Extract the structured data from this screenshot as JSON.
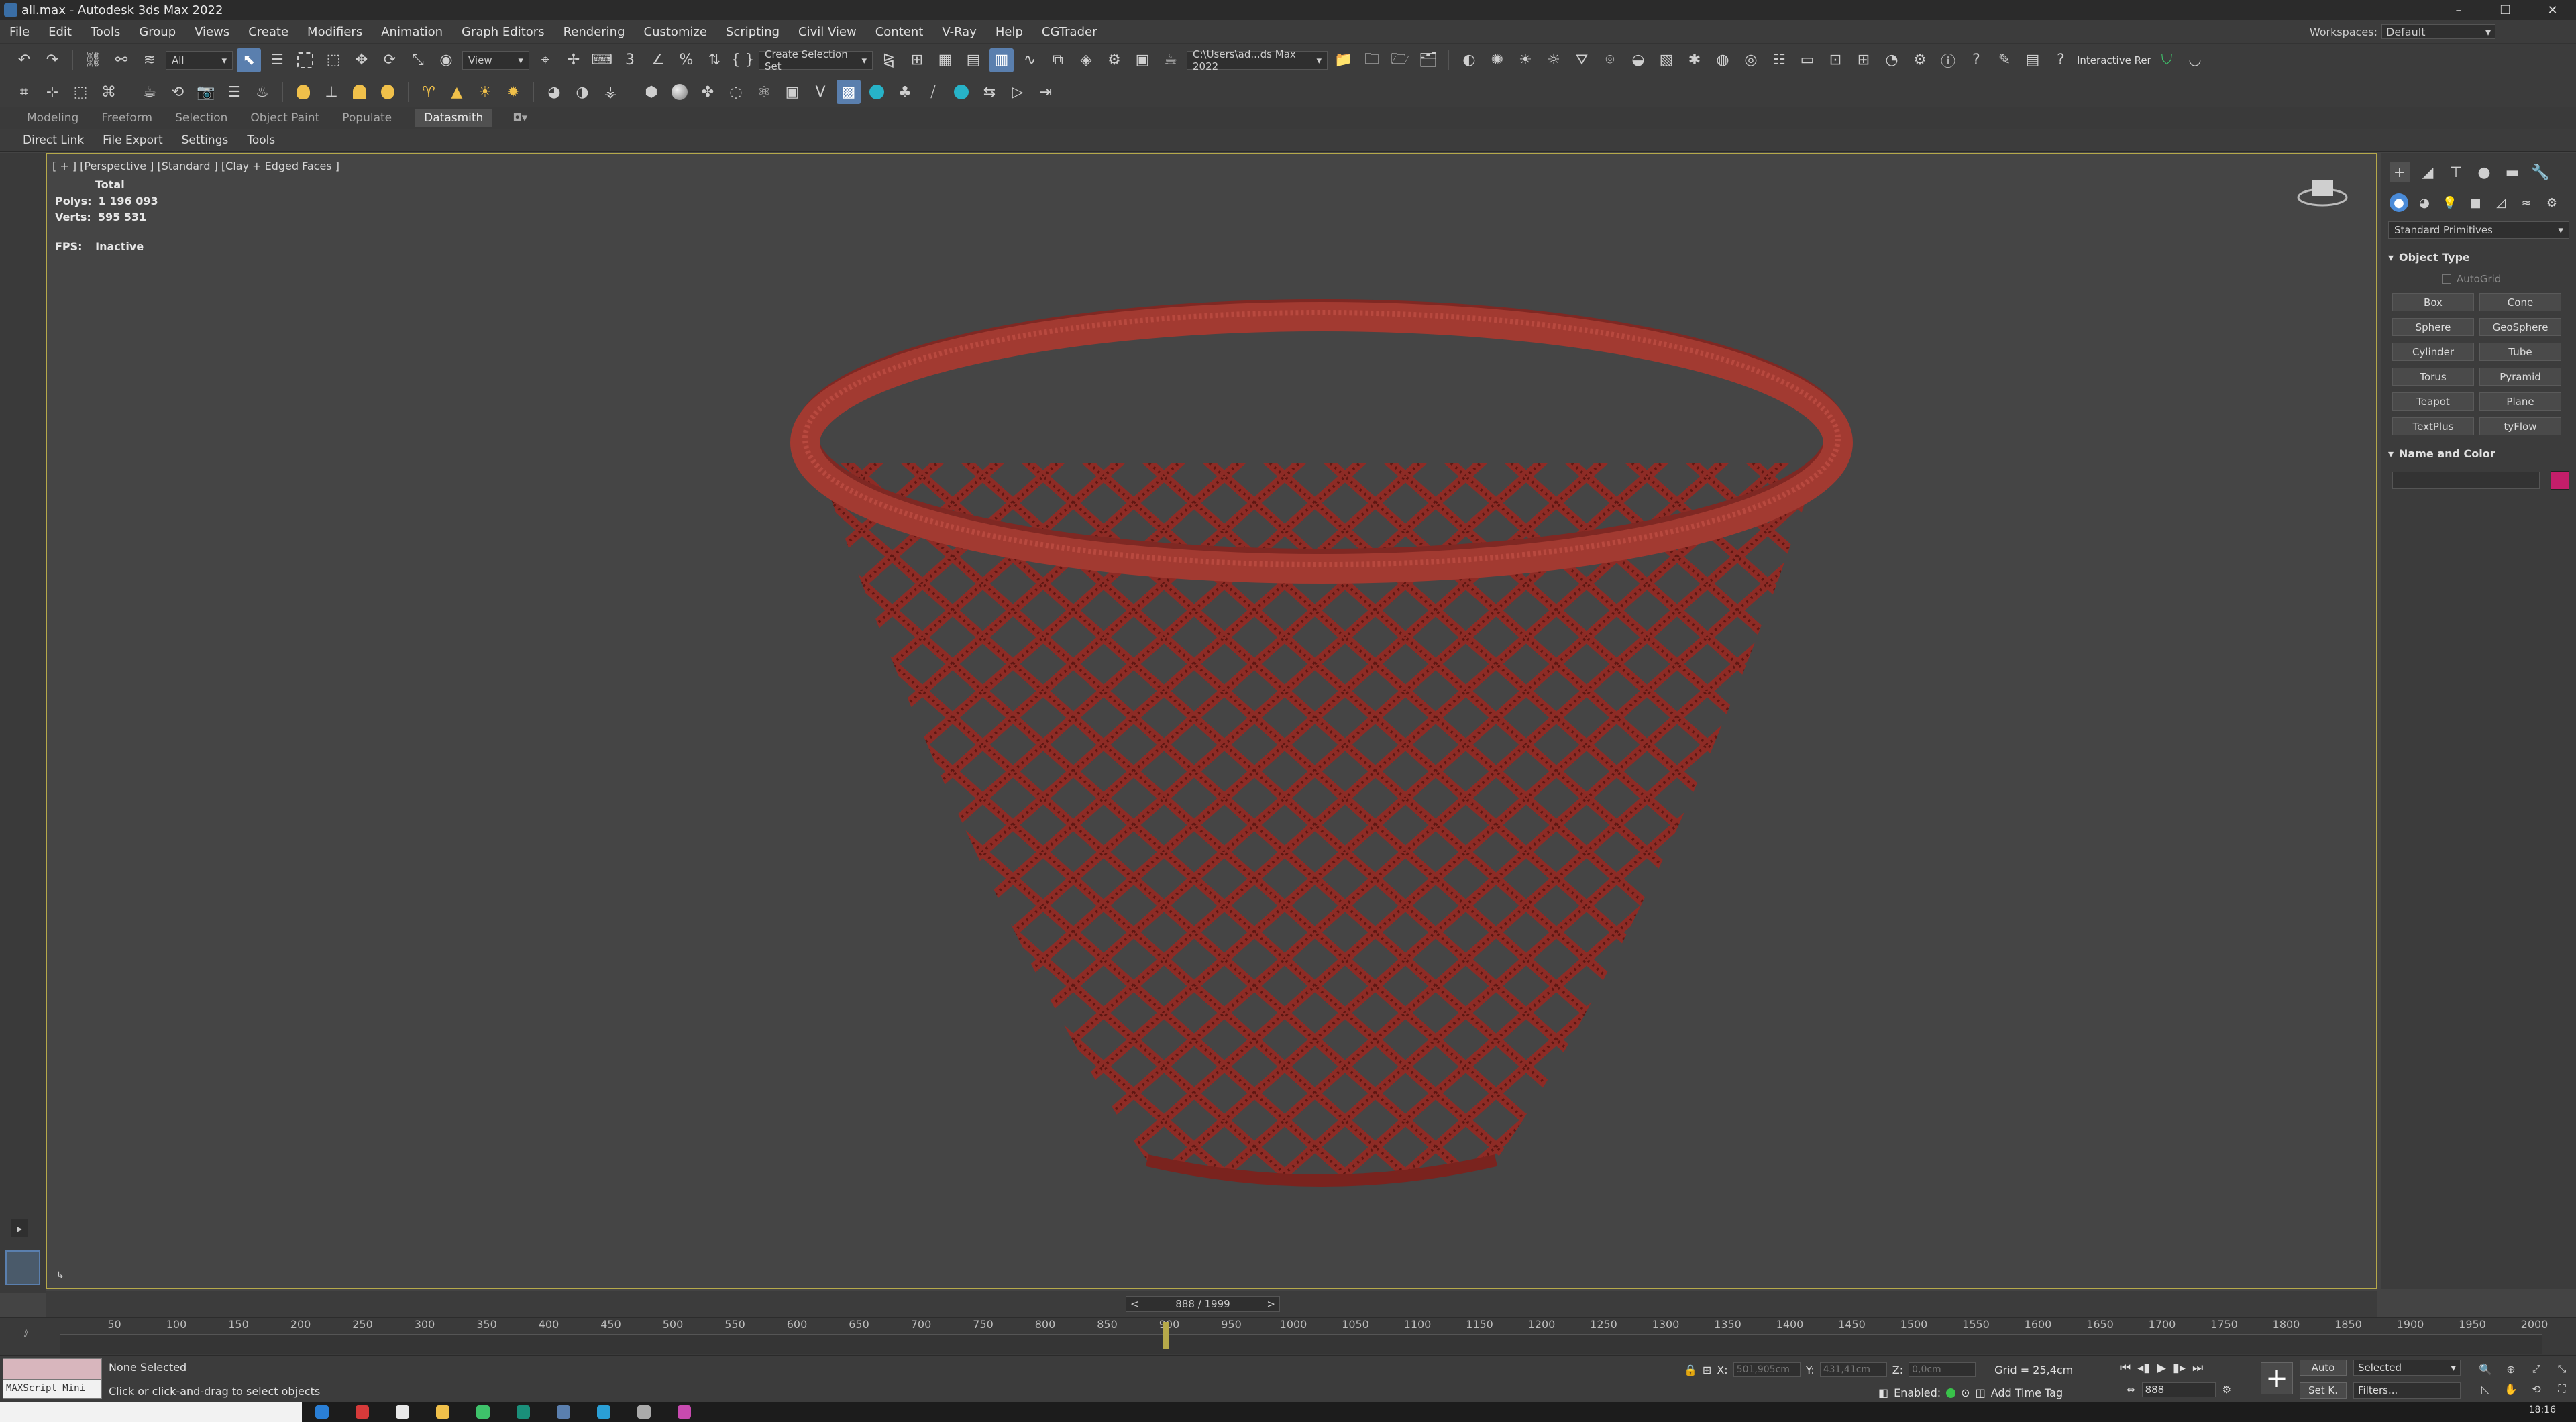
{
  "window": {
    "title": "all.max - Autodesk 3ds Max 2022",
    "controls": [
      "–",
      "❐",
      "✕"
    ]
  },
  "menu": {
    "items": [
      "File",
      "Edit",
      "Tools",
      "Group",
      "Views",
      "Create",
      "Modifiers",
      "Animation",
      "Graph Editors",
      "Rendering",
      "Customize",
      "Scripting",
      "Civil View",
      "Content",
      "V-Ray",
      "Help",
      "CGTrader"
    ],
    "workspaces_label": "Workspaces:",
    "workspaces_value": "Default"
  },
  "toolbar": {
    "filter_value": "All",
    "refcoord_value": "View",
    "selection_set_value": "Create Selection Set",
    "project_path": "C:\\Users\\ad...ds Max 2022",
    "interactive_label": "Interactive Rendering"
  },
  "ribbon": {
    "tabs": [
      "Modeling",
      "Freeform",
      "Selection",
      "Object Paint",
      "Populate",
      "Datasmith"
    ],
    "active": "Datasmith"
  },
  "subtabs": [
    "Direct Link",
    "File Export",
    "Settings",
    "Tools"
  ],
  "viewport": {
    "label": "[ + ] [Perspective ] [Standard ] [Clay + Edged Faces ]",
    "stats_header": "Total",
    "polys_label": "Polys:",
    "polys_value": "1 196 093",
    "verts_label": "Verts:",
    "verts_value": "595 531",
    "fps_label": "FPS:",
    "fps_value": "Inactive"
  },
  "command_panel": {
    "category": "Standard Primitives",
    "object_type_title": "Object Type",
    "autogrid_label": "AutoGrid",
    "buttons": [
      "Box",
      "Cone",
      "Sphere",
      "GeoSphere",
      "Cylinder",
      "Tube",
      "Torus",
      "Pyramid",
      "Teapot",
      "Plane",
      "TextPlus",
      "tyFlow"
    ],
    "name_color_title": "Name and Color",
    "color": "#c41e6a"
  },
  "timeline": {
    "slider_value": "888 / 1999",
    "ticks": [
      "50",
      "100",
      "150",
      "200",
      "250",
      "300",
      "350",
      "400",
      "450",
      "500",
      "550",
      "600",
      "650",
      "700",
      "750",
      "800",
      "850",
      "900",
      "950",
      "1000",
      "1050",
      "1100",
      "1150",
      "1200",
      "1250",
      "1300",
      "1350",
      "1400",
      "1450",
      "1500",
      "1550",
      "1600",
      "1650",
      "1700",
      "1750",
      "1800",
      "1850",
      "1900",
      "1950",
      "2000"
    ],
    "current_fraction": 0.444
  },
  "status": {
    "maxscript_label": "MAXScript Mini",
    "selection_status": "None Selected",
    "prompt": "Click or click-and-drag to select objects",
    "x_label": "X:",
    "x_value": "501,905cm",
    "y_label": "Y:",
    "y_value": "431,41cm",
    "z_label": "Z:",
    "z_value": "0,0cm",
    "grid": "Grid = 25,4cm",
    "enabled_label": "Enabled:",
    "add_time_tag": "Add Time Tag",
    "frame_value": "888",
    "auto_label": "Auto",
    "setk_label": "Set K.",
    "selected_value": "Selected",
    "filters_label": "Filters...",
    "clock": "18:16"
  },
  "colors": {
    "viewport_bg": "#454545",
    "active_border": "#b6a94a",
    "mesh": "#8e2b25",
    "accent": "#5a7fae"
  }
}
